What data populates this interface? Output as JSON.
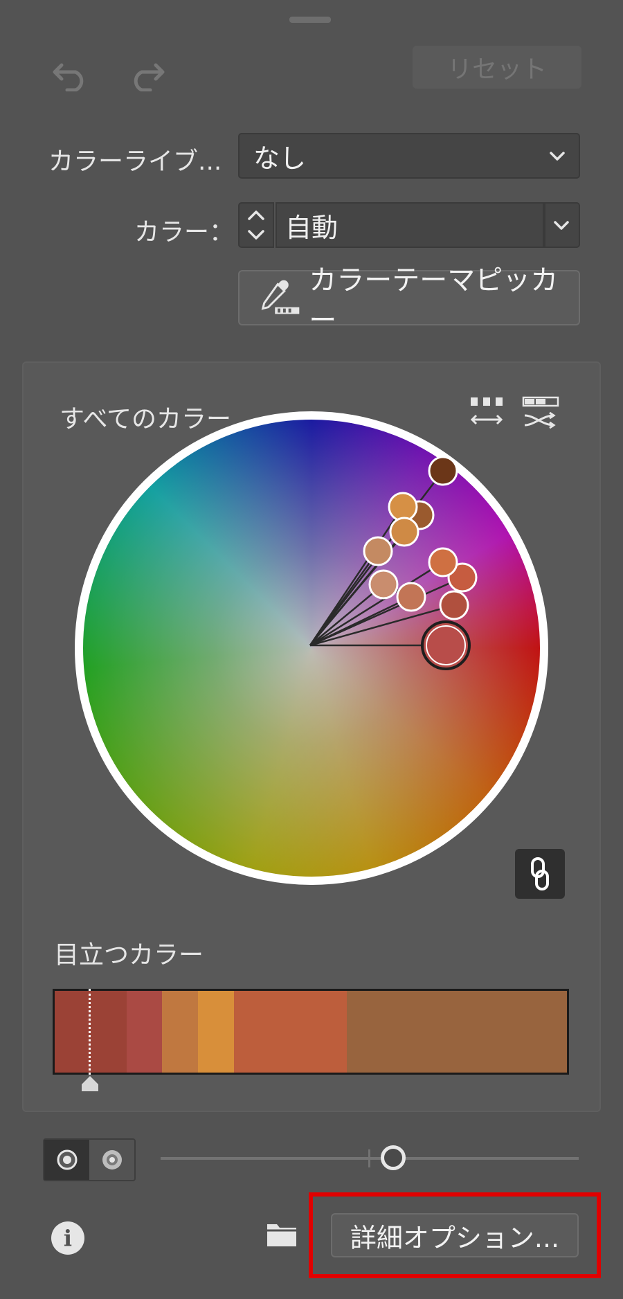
{
  "toolbar": {
    "undo_icon": "undo-arrow-icon",
    "redo_icon": "redo-arrow-icon",
    "reset_label": "リセット"
  },
  "color_library": {
    "label": "カラーライブ...",
    "value": "なし"
  },
  "color_count": {
    "label": "カラー：",
    "value": "自動"
  },
  "theme_picker": {
    "label": "カラーテーマピッカー",
    "icon": "eyedropper-icon"
  },
  "all_colors": {
    "title": "すべてのカラー",
    "tools": [
      "spread-colors-icon",
      "shuffle-colors-icon"
    ],
    "link_icon": "link-icon"
  },
  "prominent_colors": {
    "title": "目立つカラー",
    "segments": [
      {
        "color": "#9b4236",
        "share": 0.14
      },
      {
        "color": "#aa4a44",
        "share": 0.07
      },
      {
        "color": "#c07840",
        "share": 0.07
      },
      {
        "color": "#d88f3a",
        "share": 0.07
      },
      {
        "color": "#bd5e3c",
        "share": 0.22
      },
      {
        "color": "#98643e",
        "share": 0.43
      }
    ]
  },
  "bottom": {
    "info_icon": "info-icon",
    "folder_icon": "folder-icon",
    "advanced_label": "詳細オプション..."
  },
  "colors": {
    "panel_bg": "#535353",
    "highlight": "#e00000"
  }
}
